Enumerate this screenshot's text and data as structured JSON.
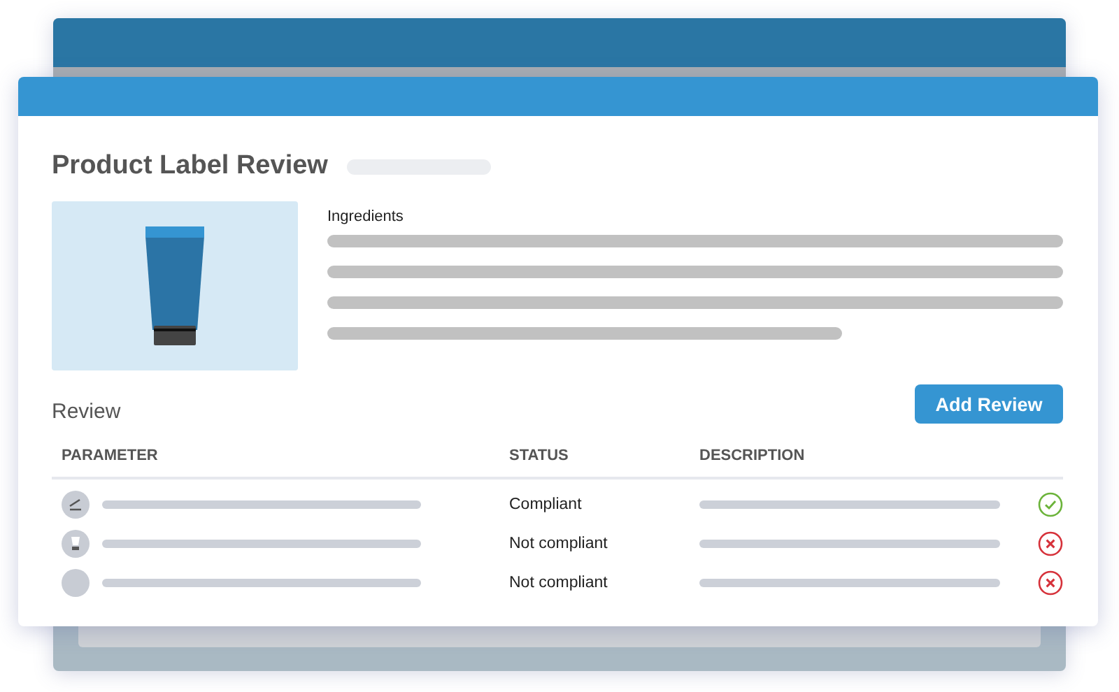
{
  "title": "Product Label Review",
  "ingredients": {
    "label": "Ingredients"
  },
  "review": {
    "heading": "Review",
    "button": "Add Review"
  },
  "table": {
    "columns": [
      "PARAMETER",
      "STATUS",
      "DESCRIPTION"
    ],
    "rows": [
      {
        "kind": "pen",
        "status": "Compliant",
        "compliant": true
      },
      {
        "kind": "tube",
        "status": "Not compliant",
        "compliant": false
      },
      {
        "kind": "blank",
        "status": "Not compliant",
        "compliant": false
      }
    ]
  }
}
